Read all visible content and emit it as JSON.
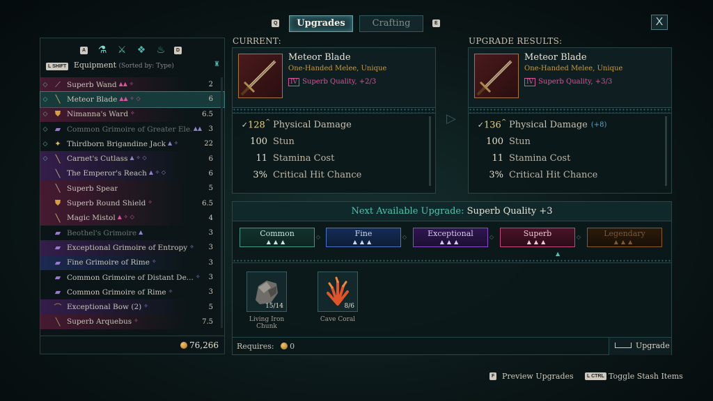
{
  "top_tabs": {
    "left_key": "Q",
    "right_key": "E",
    "upgrades": "Upgrades",
    "crafting": "Crafting",
    "close": "X"
  },
  "equipment": {
    "key_left": "A",
    "key_right": "D",
    "shift_key": "L SHIFT",
    "title": "Equipment",
    "sort": "(Sorted by: Type)",
    "gold": "76,266",
    "items": [
      {
        "name": "Superb Wand",
        "weight": "2",
        "highlight": "pink",
        "tag": "▲▲ ✧"
      },
      {
        "name": "Meteor Blade",
        "weight": "6",
        "highlight": "selected",
        "tag": "▲▲ ✧ ◇"
      },
      {
        "name": "Nimanna's Ward",
        "weight": "6.5",
        "highlight": "pink",
        "tag": "✧"
      },
      {
        "name": "Common Grimoire of Greater Ele...",
        "weight": "3",
        "highlight": "dim",
        "tag": "▲▲"
      },
      {
        "name": "Thirdborn Brigandine Jack",
        "weight": "22",
        "highlight": "",
        "tag": "▲ ✧"
      },
      {
        "name": "Carnet's Cutlass",
        "weight": "6",
        "highlight": "purple",
        "tag": "▲ ✧ ◇"
      },
      {
        "name": "The Emperor's Reach",
        "weight": "6",
        "highlight": "purple",
        "tag": "▲ ✧ ◇"
      },
      {
        "name": "Superb Spear",
        "weight": "5",
        "highlight": "pink",
        "tag": ""
      },
      {
        "name": "Superb Round Shield",
        "weight": "6.5",
        "highlight": "pink",
        "tag": "✧"
      },
      {
        "name": "Magic Mistol",
        "weight": "4",
        "highlight": "pink",
        "tag": "▲ ✧ ◇"
      },
      {
        "name": "Beothel's Grimoire",
        "weight": "3",
        "highlight": "dim",
        "tag": "▲"
      },
      {
        "name": "Exceptional Grimoire of Entropy",
        "weight": "3",
        "highlight": "purple",
        "tag": "✧"
      },
      {
        "name": "Fine Grimoire of Rime",
        "weight": "3",
        "highlight": "blue",
        "tag": "✧"
      },
      {
        "name": "Common Grimoire of Distant De...",
        "weight": "3",
        "highlight": "",
        "tag": "✧"
      },
      {
        "name": "Common Grimoire of Rime",
        "weight": "3",
        "highlight": "",
        "tag": "✧"
      },
      {
        "name": "Exceptional Bow (2)",
        "weight": "5",
        "highlight": "purple",
        "tag": "✧"
      },
      {
        "name": "Superb Arquebus",
        "weight": "7.5",
        "highlight": "pink",
        "tag": "✧"
      }
    ]
  },
  "current": {
    "label": "CURRENT:",
    "name": "Meteor Blade",
    "subtitle": "One-Handed Melee, Unique",
    "tier_roman": "IV",
    "quality": "Superb Quality, +2/3",
    "stats": [
      {
        "value": "128",
        "label": "Physical Damage",
        "check": "✓",
        "arrow": "^"
      },
      {
        "value": "100",
        "label": "Stun"
      },
      {
        "value": "11",
        "label": "Stamina Cost"
      },
      {
        "value": "3%",
        "label": "Critical Hit Chance"
      }
    ]
  },
  "results": {
    "label": "UPGRADE RESULTS:",
    "name": "Meteor Blade",
    "subtitle": "One-Handed Melee, Unique",
    "tier_roman": "IV",
    "quality": "Superb Quality, +3/3",
    "stats": [
      {
        "value": "136",
        "label": "Physical Damage",
        "check": "✓",
        "arrow": "^",
        "bonus": "(+8)"
      },
      {
        "value": "100",
        "label": "Stun"
      },
      {
        "value": "11",
        "label": "Stamina Cost"
      },
      {
        "value": "3%",
        "label": "Critical Hit Chance"
      }
    ]
  },
  "upgrade": {
    "next_label": "Next Available Upgrade:",
    "next_value": "Superb Quality +3",
    "tiers": [
      "Common",
      "Fine",
      "Exceptional",
      "Superb",
      "Legendary"
    ],
    "materials": [
      {
        "name": "Living Iron Chunk",
        "count": "15/14"
      },
      {
        "name": "Cave Coral",
        "count": "8/6"
      }
    ],
    "requires_label": "Requires:",
    "requires_gold": "0",
    "button": "Upgrade"
  },
  "hints": {
    "preview_key": "F",
    "preview": "Preview Upgrades",
    "stash_key": "L CTRL",
    "stash": "Toggle Stash Items"
  },
  "colors": {
    "accent_teal": "#4fc3b0",
    "superb": "#d6559a",
    "unique_gold": "#c99a3c"
  }
}
